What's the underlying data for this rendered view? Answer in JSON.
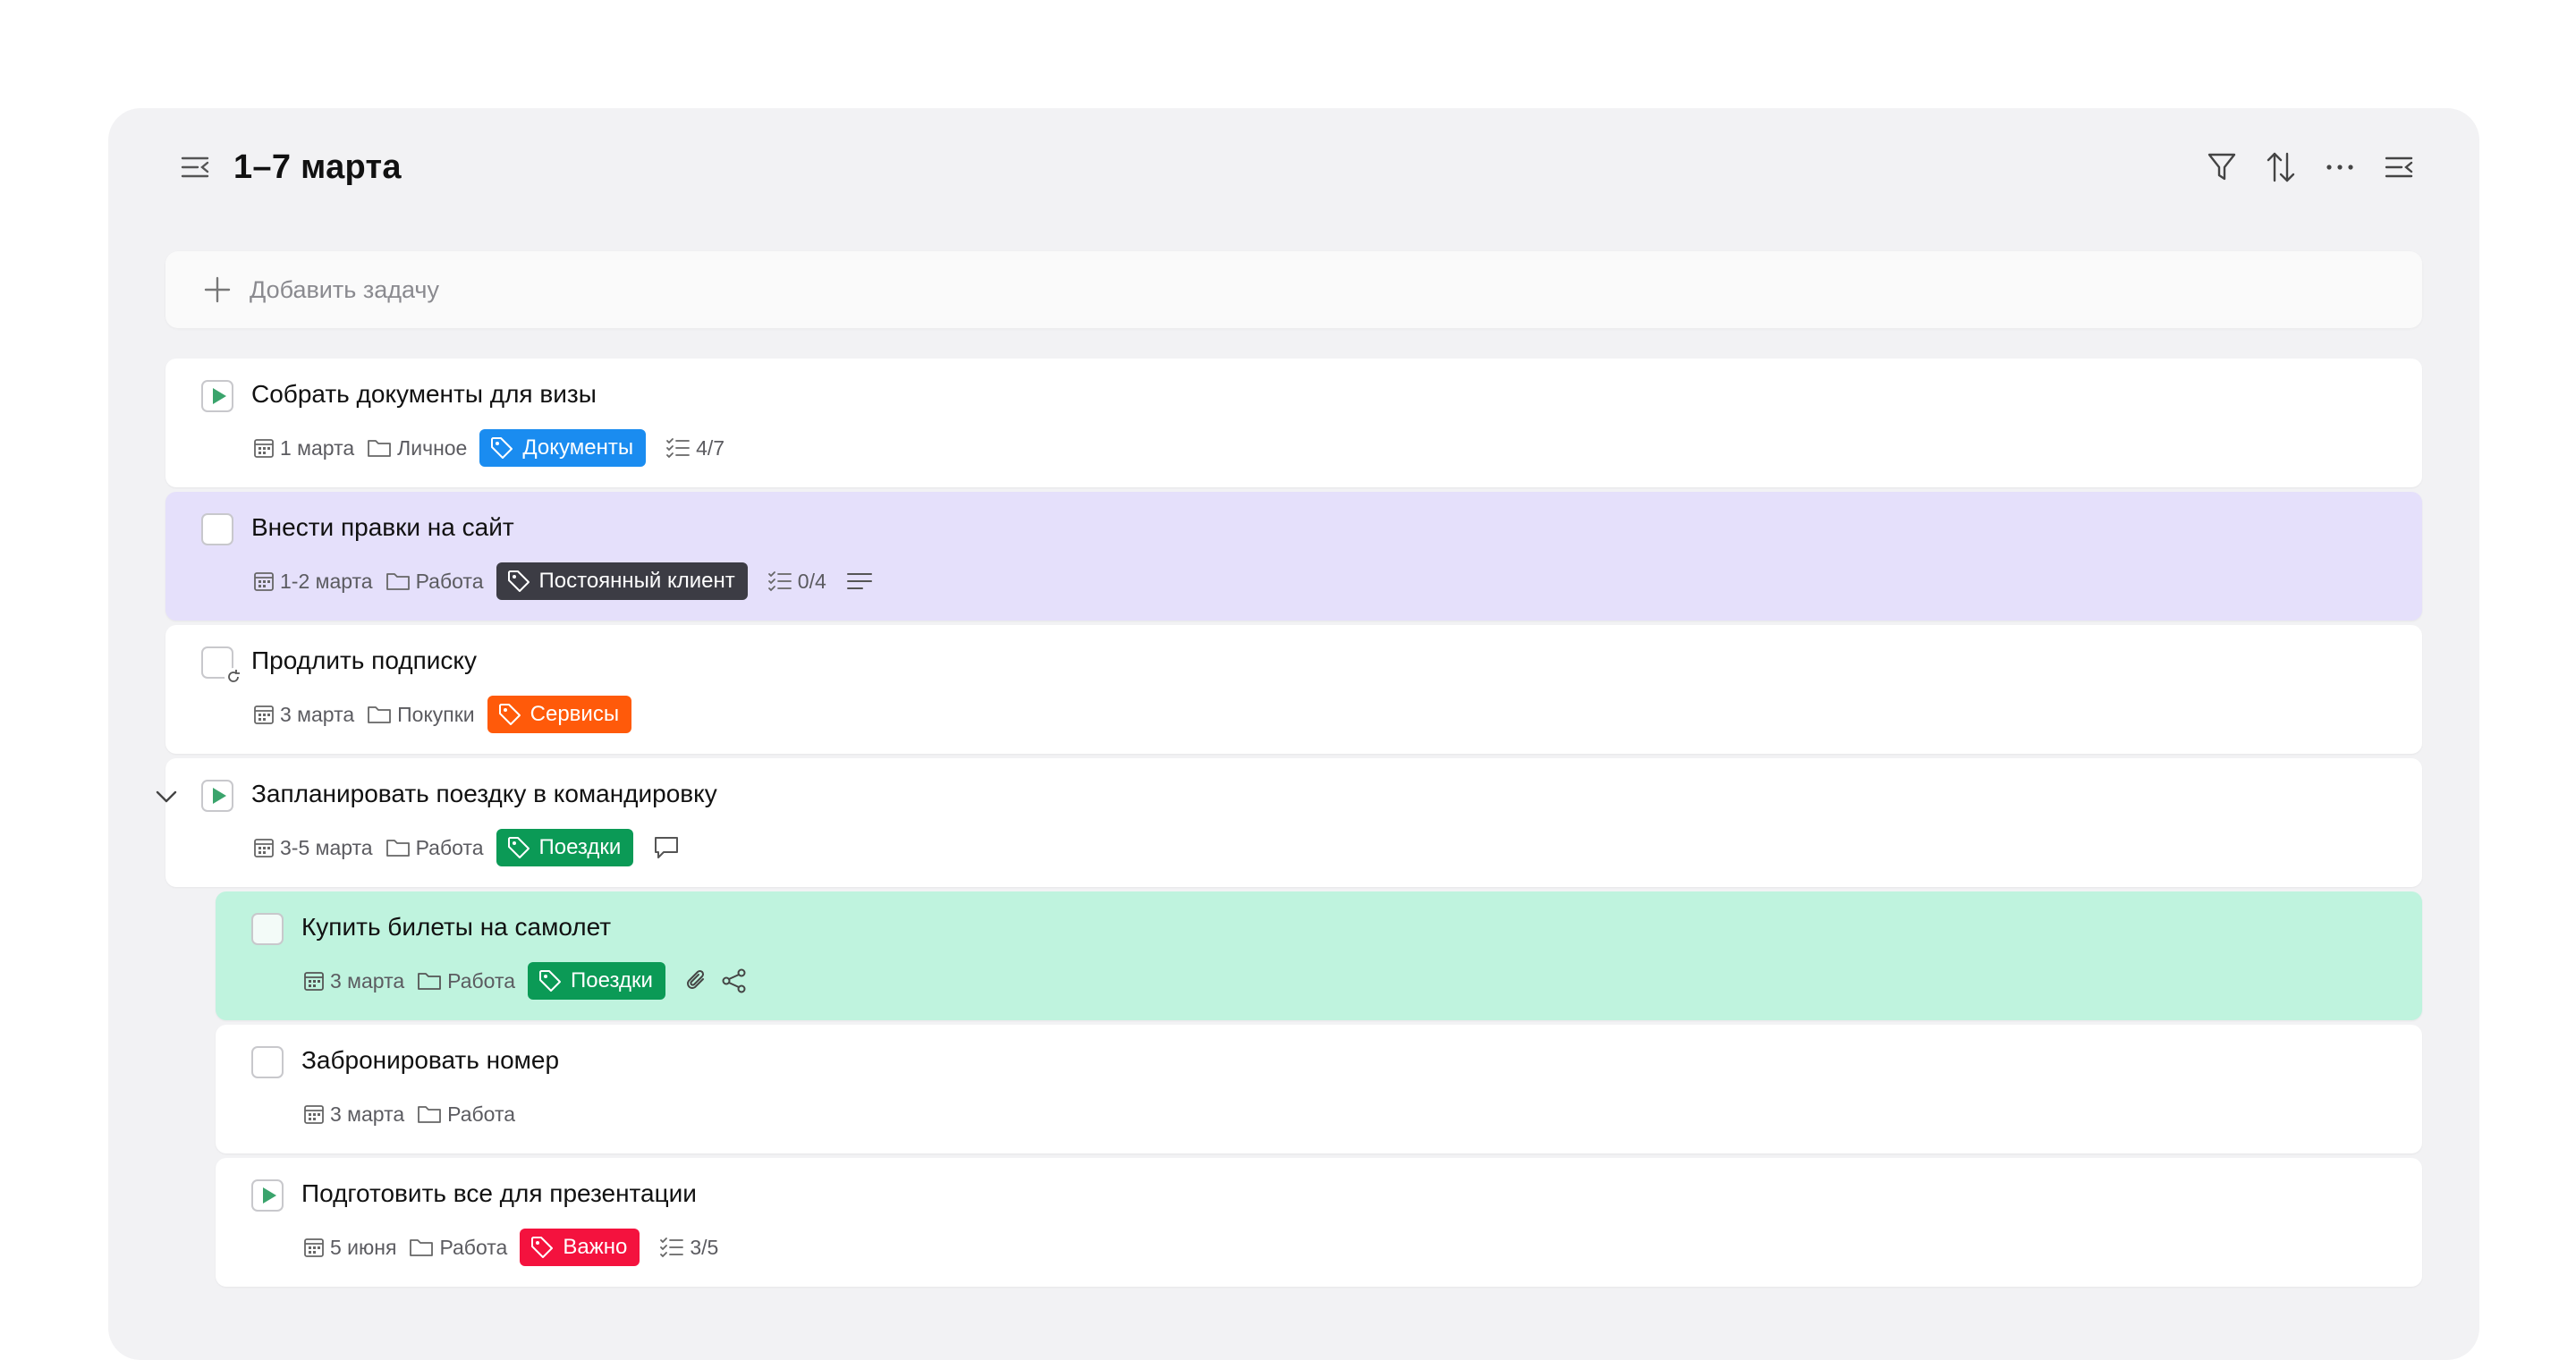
{
  "header": {
    "title": "1–7 марта",
    "menu_icon": "sidebar-toggle-icon",
    "toolbar": [
      "filter-icon",
      "sort-icon",
      "more-icon",
      "panel-toggle-icon"
    ]
  },
  "add_task": {
    "placeholder": "Добавить задачу"
  },
  "colors": {
    "panel_bg": "#f2f2f4",
    "play_green": "#3aa46c",
    "row_purple": "#e5e0fb",
    "row_green": "#bff3de",
    "tag_blue": "#1a8cf0",
    "tag_dark": "#3c3c44",
    "tag_orange": "#ff5a0a",
    "tag_green": "#0b9a56",
    "tag_red": "#f4123e"
  },
  "tasks": [
    {
      "title": "Собрать документы для визы",
      "state": "play",
      "date": "1 марта",
      "project": "Личное",
      "tag": "Документы",
      "subtasks": "4/7"
    },
    {
      "title": "Внести правки на сайт",
      "state": "empty",
      "date": "1-2 марта",
      "project": "Работа",
      "tag": "Постоянный клиент",
      "subtasks": "0/4",
      "has_note": true
    },
    {
      "title": "Продлить подписку",
      "state": "repeat",
      "date": "3 марта",
      "project": "Покупки",
      "tag": "Сервисы"
    },
    {
      "title": "Запланировать поездку в командировку",
      "state": "play",
      "expanded": true,
      "date": "3-5 марта",
      "project": "Работа",
      "tag": "Поездки",
      "has_comment": true
    },
    {
      "title": "Купить билеты на самолет",
      "state": "empty",
      "date": "3 марта",
      "project": "Работа",
      "tag": "Поездки",
      "has_attachment": true,
      "has_share": true
    },
    {
      "title": "Забронировать номер",
      "state": "empty",
      "date": "3 марта",
      "project": "Работа"
    },
    {
      "title": "Подготовить все для презентации",
      "state": "play",
      "date": "5 июня",
      "project": "Работа",
      "tag": "Важно",
      "subtasks": "3/5"
    }
  ]
}
